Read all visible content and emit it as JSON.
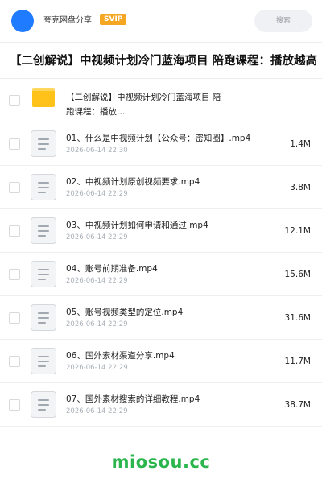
{
  "header": {
    "username": "夸克网盘分享",
    "badge": "SVIP",
    "search_placeholder": "搜索"
  },
  "page_title": "【二创解说】中视频计划冷门蓝海项目 陪跑课程：播放越高",
  "folder": {
    "name": "【二创解说】中视频计划冷门蓝海项目 陪跑课程：播放…"
  },
  "files": [
    {
      "name": "01、什么是中视频计划【公众号：密知圈】.mp4",
      "date": "2026-06-14 22:30",
      "size": "1.4M"
    },
    {
      "name": "02、中视频计划原创视频要求.mp4",
      "date": "2026-06-14 22:29",
      "size": "3.8M"
    },
    {
      "name": "03、中视频计划如何申请和通过.mp4",
      "date": "2026-06-14 22:29",
      "size": "12.1M"
    },
    {
      "name": "04、账号前期准备.mp4",
      "date": "2026-06-14 22:29",
      "size": "15.6M"
    },
    {
      "name": "05、账号视频类型的定位.mp4",
      "date": "2026-06-14 22:29",
      "size": "31.6M"
    },
    {
      "name": "06、国外素材渠道分享.mp4",
      "date": "2026-06-14 22:29",
      "size": "11.7M"
    },
    {
      "name": "07、国外素材搜索的详细教程.mp4",
      "date": "2026-06-14 22:29",
      "size": "38.7M"
    }
  ],
  "watermark": "miosou.cc",
  "colors": {
    "avatar": "#1f7bff",
    "badge": "#f5a623",
    "folder": "#ffc21a",
    "watermark": "#2bb54d"
  }
}
